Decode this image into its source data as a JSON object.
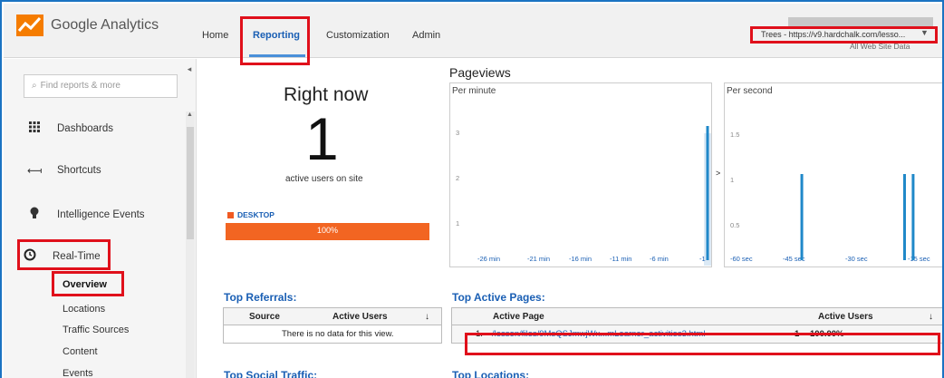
{
  "app": {
    "title": "Google Analytics"
  },
  "nav": {
    "home": "Home",
    "reporting": "Reporting",
    "customization": "Customization",
    "admin": "Admin"
  },
  "account": {
    "name": "Trees - https://v9.hardchalk.com/lesso...",
    "view": "All Web Site Data"
  },
  "sidebar": {
    "search_placeholder": "Find reports & more",
    "items": [
      {
        "label": "Dashboards",
        "icon": "grid-icon"
      },
      {
        "label": "Shortcuts",
        "icon": "shortcut-arrow-icon"
      },
      {
        "label": "Intelligence Events",
        "icon": "lightbulb-icon"
      },
      {
        "label": "Real-Time",
        "icon": "clock-icon"
      }
    ],
    "realtime_sub": [
      "Overview",
      "Locations",
      "Traffic Sources",
      "Content",
      "Events"
    ]
  },
  "right_now": {
    "title": "Right now",
    "active_users": "1",
    "caption": "active users on site",
    "device_label": "DESKTOP",
    "device_percent": 100,
    "device_percent_label": "100%"
  },
  "pageviews": {
    "title": "Pageviews",
    "per_minute": {
      "label": "Per minute",
      "y_ticks": [
        "3",
        "2",
        "1"
      ],
      "x_ticks": [
        "-26 min",
        "-21 min",
        "-16 min",
        "-11 min",
        "-6 min",
        "-1"
      ],
      "ymax": 3,
      "bars": [
        {
          "x": -1,
          "y": 3
        }
      ]
    },
    "per_second": {
      "label": "Per second",
      "y_ticks": [
        "1.5",
        "1",
        "0.5"
      ],
      "x_ticks": [
        "-60 sec",
        "-45 sec",
        "-30 sec",
        "-15 sec"
      ],
      "ymax": 1.5,
      "bars": [
        {
          "x": -45,
          "y": 1
        },
        {
          "x": -21,
          "y": 1
        },
        {
          "x": -19,
          "y": 1
        }
      ]
    }
  },
  "top_referrals": {
    "title": "Top Referrals:",
    "col_source": "Source",
    "col_users": "Active Users",
    "empty": "There is no data for this view."
  },
  "top_active_pages": {
    "title": "Top Active Pages:",
    "col_page": "Active Page",
    "col_users": "Active Users",
    "rows": [
      {
        "index": "1.",
        "page": "/lesson/files/9MsQSJmwjWx...mLearner_activities3.html",
        "users": "1",
        "percent": "100.00%"
      }
    ]
  },
  "top_social": {
    "title": "Top Social Traffic:"
  },
  "top_locations": {
    "title": "Top Locations:"
  },
  "colors": {
    "accent": "#1a5fb4",
    "desktop": "#f26522",
    "bar": "#1f88c9",
    "highlight": "#e0101b"
  }
}
